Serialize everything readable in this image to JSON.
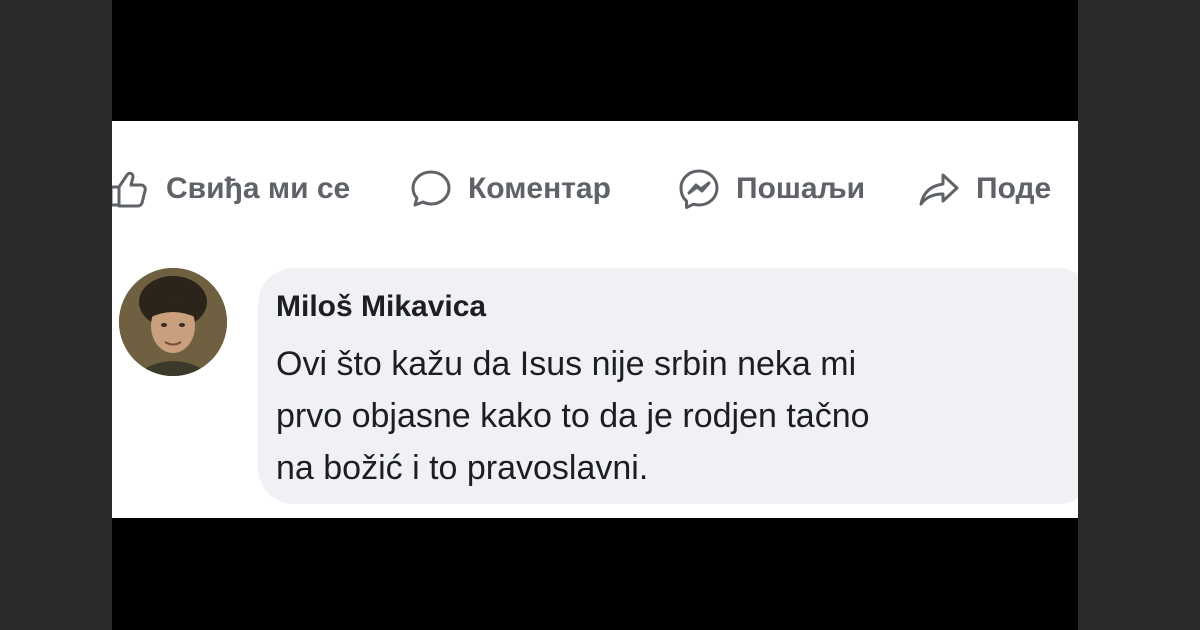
{
  "actions": {
    "like_label": "Свиђа ми се",
    "comment_label": "Коментар",
    "send_label": "Пошаљи",
    "share_label": "Поде"
  },
  "comment": {
    "author": "Miloš Mikavica",
    "lines": [
      "Ovi što kažu da Isus nije srbin neka mi",
      "prvo objasne kako to da je rodjen tačno",
      "na božić i to pravoslavni."
    ]
  },
  "icons": {
    "like": "thumbs-up-icon",
    "comment": "speech-bubble-icon",
    "send": "messenger-icon",
    "share": "share-arrow-icon"
  },
  "colors": {
    "frame": "#000000",
    "outer": "#2a2a2a",
    "panel": "#ffffff",
    "action_text": "#5f6368",
    "bubble": "#eff1f4",
    "text": "#1c1e21"
  }
}
